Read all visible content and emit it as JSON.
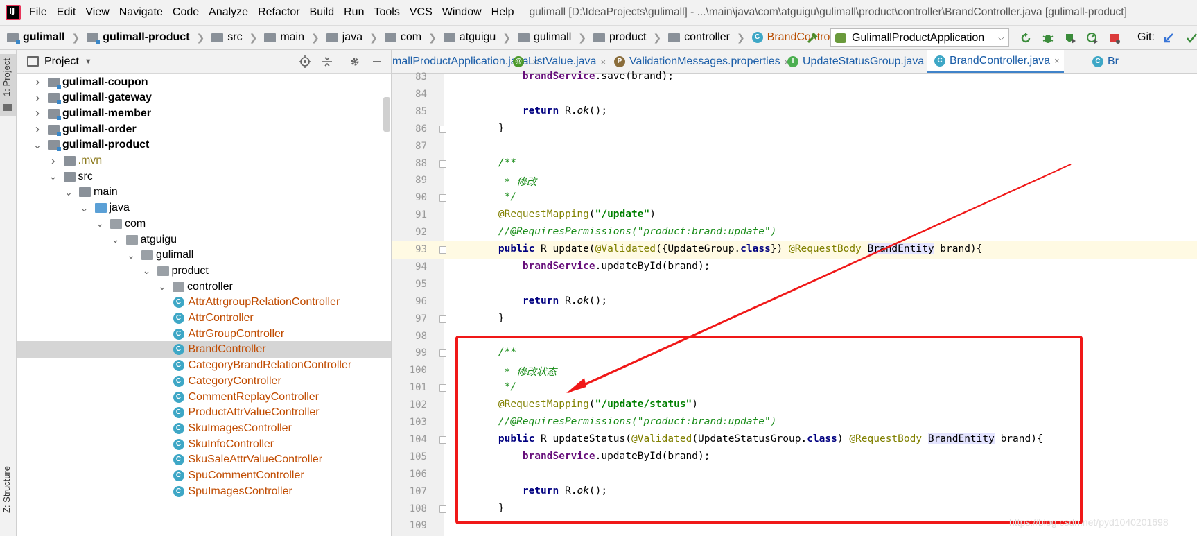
{
  "menubar": {
    "items": [
      "File",
      "Edit",
      "View",
      "Navigate",
      "Code",
      "Analyze",
      "Refactor",
      "Build",
      "Run",
      "Tools",
      "VCS",
      "Window",
      "Help"
    ],
    "title": "gulimall [D:\\IdeaProjects\\gulimall] - ...\\main\\java\\com\\atguigu\\gulimall\\product\\controller\\BrandController.java [gulimall-product]"
  },
  "navbar": {
    "crumbs": [
      "gulimall",
      "gulimall-product",
      "src",
      "main",
      "java",
      "com",
      "atguigu",
      "gulimall",
      "product",
      "controller",
      "BrandController"
    ],
    "run_config": "GulimallProductApplication",
    "git_label": "Git:"
  },
  "left_strip": {
    "project_tab": "1: Project",
    "structure_tab": "Z: Structure"
  },
  "project_panel": {
    "title": "Project",
    "tree": [
      {
        "label": "gulimall-coupon",
        "type": "module",
        "expanded": false
      },
      {
        "label": "gulimall-gateway",
        "type": "module",
        "expanded": false
      },
      {
        "label": "gulimall-member",
        "type": "module",
        "expanded": false
      },
      {
        "label": "gulimall-order",
        "type": "module",
        "expanded": false
      },
      {
        "label": "gulimall-product",
        "type": "module",
        "expanded": true
      },
      {
        "label": ".mvn",
        "type": "folder",
        "expanded": false
      },
      {
        "label": "src",
        "type": "folder",
        "expanded": true
      },
      {
        "label": "main",
        "type": "folder",
        "expanded": true
      },
      {
        "label": "java",
        "type": "source",
        "expanded": true
      },
      {
        "label": "com",
        "type": "package",
        "expanded": true
      },
      {
        "label": "atguigu",
        "type": "package",
        "expanded": true
      },
      {
        "label": "gulimall",
        "type": "package",
        "expanded": true
      },
      {
        "label": "product",
        "type": "package",
        "expanded": true
      },
      {
        "label": "controller",
        "type": "package",
        "expanded": true
      },
      {
        "label": "AttrAttrgroupRelationController",
        "type": "class"
      },
      {
        "label": "AttrController",
        "type": "class"
      },
      {
        "label": "AttrGroupController",
        "type": "class"
      },
      {
        "label": "BrandController",
        "type": "class",
        "selected": true
      },
      {
        "label": "CategoryBrandRelationController",
        "type": "class"
      },
      {
        "label": "CategoryController",
        "type": "class"
      },
      {
        "label": "CommentReplayController",
        "type": "class"
      },
      {
        "label": "ProductAttrValueController",
        "type": "class"
      },
      {
        "label": "SkuImagesController",
        "type": "class"
      },
      {
        "label": "SkuInfoController",
        "type": "class"
      },
      {
        "label": "SkuSaleAttrValueController",
        "type": "class"
      },
      {
        "label": "SpuCommentController",
        "type": "class"
      },
      {
        "label": "SpuImagesController",
        "type": "class"
      }
    ]
  },
  "editor_tabs": [
    {
      "label": "mallProductApplication.java",
      "icon": "class-icon",
      "active": false
    },
    {
      "label": "ListValue.java",
      "icon": "annotation-icon",
      "active": false
    },
    {
      "label": "ValidationMessages.properties",
      "icon": "properties-icon",
      "active": false
    },
    {
      "label": "UpdateStatusGroup.java",
      "icon": "interface-icon",
      "active": false
    },
    {
      "label": "BrandController.java",
      "icon": "class-icon",
      "active": true
    },
    {
      "label": "Br",
      "icon": "class-icon",
      "active": false
    }
  ],
  "code_lines": [
    {
      "n": "83",
      "html": "        <span class=\"fld\">brandService</span>.save(brand);"
    },
    {
      "n": "84",
      "html": ""
    },
    {
      "n": "85",
      "html": "        <span class=\"kw\">return</span> R.<span class=\"itl\">ok</span>();"
    },
    {
      "n": "86",
      "html": "    }"
    },
    {
      "n": "87",
      "html": ""
    },
    {
      "n": "88",
      "html": "    <span class=\"cmt\">/**</span>"
    },
    {
      "n": "89",
      "html": "<span class=\"cmt\">     * 修改</span>"
    },
    {
      "n": "90",
      "html": "<span class=\"cmt\">     */</span>"
    },
    {
      "n": "91",
      "html": "    <span class=\"ann\">@RequestMapping</span>(<span class=\"str\">\"/update\"</span>)"
    },
    {
      "n": "92",
      "html": "    <span class=\"cmt\">//@RequiresPermissions(\"product:brand:update\")</span>"
    },
    {
      "n": "93",
      "html": "    <span class=\"kw\">public</span> R update(<span class=\"ann\">@Validated</span>({UpdateGroup.<span class=\"kw\">class</span>}) <span class=\"ann\">@RequestBody</span> <span class=\"hlref\">BrandEntity</span> brand){"
    },
    {
      "n": "94",
      "html": "        <span class=\"fld\">brandService</span>.updateById(brand);"
    },
    {
      "n": "95",
      "html": ""
    },
    {
      "n": "96",
      "html": "        <span class=\"kw\">return</span> R.<span class=\"itl\">ok</span>();"
    },
    {
      "n": "97",
      "html": "    }"
    },
    {
      "n": "98",
      "html": ""
    },
    {
      "n": "99",
      "html": "    <span class=\"cmt\">/**</span>"
    },
    {
      "n": "100",
      "html": "<span class=\"cmt\">     * 修改状态</span>"
    },
    {
      "n": "101",
      "html": "<span class=\"cmt\">     */</span>"
    },
    {
      "n": "102",
      "html": "    <span class=\"ann\">@RequestMapping</span>(<span class=\"str\">\"/update/status\"</span>)"
    },
    {
      "n": "103",
      "html": "    <span class=\"cmt\">//@RequiresPermissions(\"product:brand:update\")</span>"
    },
    {
      "n": "104",
      "html": "    <span class=\"kw\">public</span> R updateStatus(<span class=\"ann\">@Validated</span>(UpdateStatusGroup.<span class=\"kw\">class</span>) <span class=\"ann\">@RequestBody</span> <span class=\"hlref\">BrandEntity</span> brand){"
    },
    {
      "n": "105",
      "html": "        <span class=\"fld\">brandService</span>.updateById(brand);"
    },
    {
      "n": "106",
      "html": ""
    },
    {
      "n": "107",
      "html": "        <span class=\"kw\">return</span> R.<span class=\"itl\">ok</span>();"
    },
    {
      "n": "108",
      "html": "    }"
    },
    {
      "n": "109",
      "html": ""
    }
  ],
  "current_line": "93",
  "watermark": "https://blog.csdn.net/pyd1040201698",
  "colors": {
    "annotation_red": "#f01818",
    "class_orange": "#c04b00",
    "link_blue": "#1c5ea8"
  }
}
